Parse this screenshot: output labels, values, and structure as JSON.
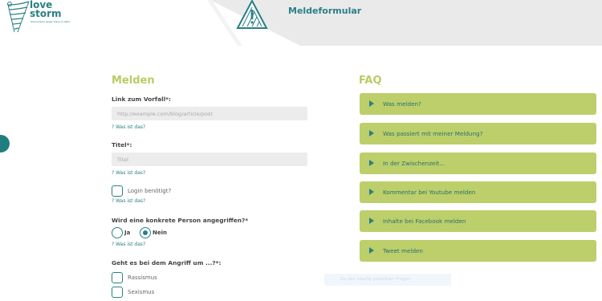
{
  "header": {
    "logo_line1": "love",
    "logo_line2": "storm",
    "logo_tagline": "Gemeinsam gegen Hass im Netz",
    "title": "Meldeformular"
  },
  "form": {
    "heading": "Melden",
    "link_label": "Link zum Vorfall*:",
    "link_placeholder": "http://example.com/blog/article/post",
    "help": "? Was ist das?",
    "title_label": "Titel*:",
    "title_placeholder": "Titel",
    "login_label": "Login benötigt?",
    "person_question": "Wird eine konkrete Person angegriffen?*",
    "yes_label": "Ja",
    "no_label": "Nein",
    "no_selected": true,
    "attack_question": "Geht es bei dem Angriff um ...?*:",
    "options": [
      "Rassismus",
      "Sexismus"
    ]
  },
  "faq": {
    "heading": "FAQ",
    "items": [
      "Was melden?",
      "Was passiert mit meiner Meldung?",
      "In der Zwischenzeit...",
      "Kommentar bei Youtube melden",
      "Inhalte bei Facebook melden",
      "Tweet melden"
    ]
  },
  "overlay": {
    "faded_text": "Zu den häufig gestellten Fragen"
  },
  "colors": {
    "teal": "#2a7f86",
    "green": "#b8cc62",
    "faq_bg": "#bccf6a"
  }
}
